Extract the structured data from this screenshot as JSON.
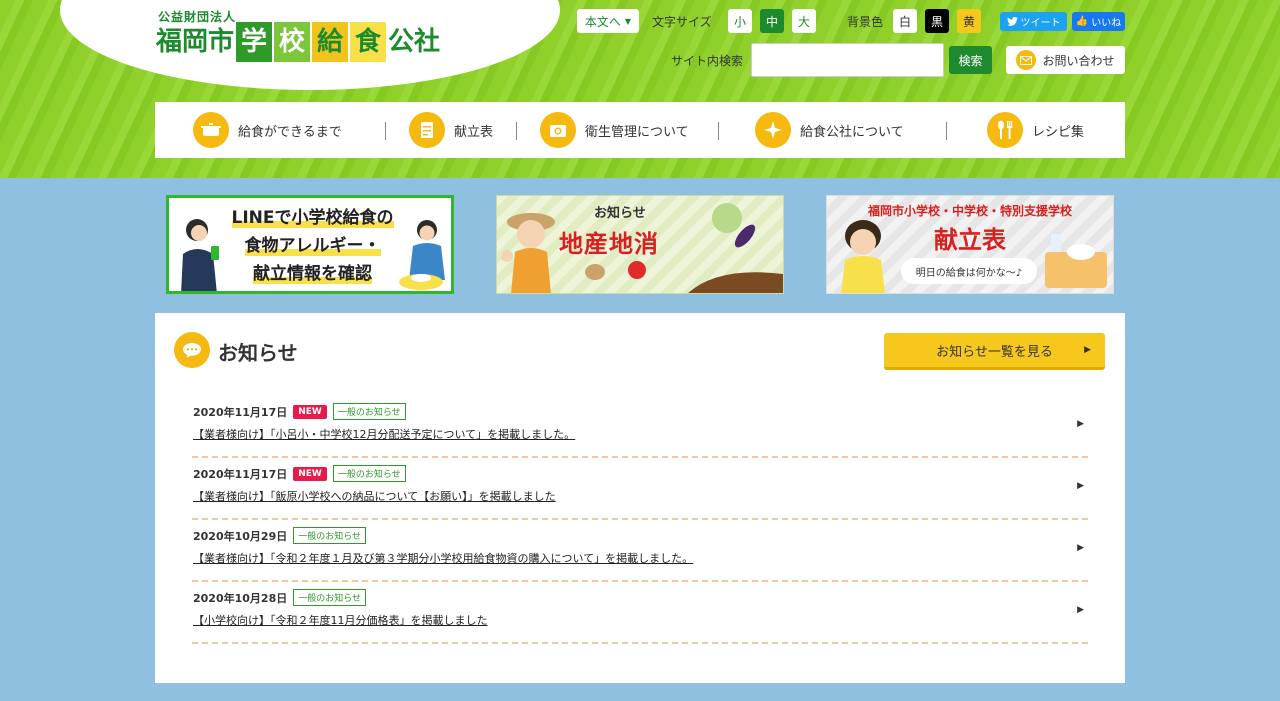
{
  "logo": {
    "org_type": "公益財団法人",
    "name_part1": "福岡市",
    "name_boxes": [
      "学",
      "校",
      "給",
      "食"
    ],
    "name_part2": "公社"
  },
  "utility": {
    "skip_label": "本文へ",
    "font_size_label": "文字サイズ",
    "font_sizes": [
      "小",
      "中",
      "大"
    ],
    "bg_color_label": "背景色",
    "bg_colors": [
      {
        "label": "白",
        "bg": "#ffffff",
        "fg": "#333333"
      },
      {
        "label": "黒",
        "bg": "#000000",
        "fg": "#ffffff"
      },
      {
        "label": "黄",
        "bg": "#f7c81c",
        "fg": "#333333"
      }
    ],
    "tweet_label": "ツイート",
    "like_label": "いいね",
    "search_label": "サイト内検索",
    "search_button": "検索",
    "search_value": "",
    "contact_label": "お問い合わせ"
  },
  "nav": {
    "items": [
      {
        "label": "給食ができるまで",
        "icon": "pot-icon"
      },
      {
        "label": "献立表",
        "icon": "document-icon"
      },
      {
        "label": "衛生管理について",
        "icon": "camera-icon"
      },
      {
        "label": "給食公社について",
        "icon": "sparkle-icon"
      },
      {
        "label": "レシピ集",
        "icon": "utensils-icon"
      }
    ]
  },
  "banners": {
    "line": {
      "lines": [
        "LINEで小学校給食の",
        "食物アレルギー・",
        "献立情報を確認"
      ]
    },
    "local": {
      "label": "お知らせ",
      "title": "地産地消"
    },
    "menu": {
      "subtitle": "福岡市小学校・中学校・特別支援学校",
      "title": "献立表",
      "bubble": "明日の給食は何かな〜♪"
    }
  },
  "news": {
    "heading": "お知らせ",
    "view_all": "お知らせ一覧を見る",
    "items": [
      {
        "date": "2020年11月17日",
        "new": "NEW",
        "category": "一般のお知らせ",
        "title": "【業者様向け】「小呂小・中学校12月分配送予定について」を掲載しました。"
      },
      {
        "date": "2020年11月17日",
        "new": "NEW",
        "category": "一般のお知らせ",
        "title": "【業者様向け】「飯原小学校への納品について【お願い】」を掲載しました"
      },
      {
        "date": "2020年10月29日",
        "new": "",
        "category": "一般のお知らせ",
        "title": "【業者様向け】「令和２年度１月及び第３学期分小学校用給食物資の購入について」を掲載しました。"
      },
      {
        "date": "2020年10月28日",
        "new": "",
        "category": "一般のお知らせ",
        "title": "【小学校向け】「令和２年度11月分価格表」を掲載しました"
      }
    ]
  },
  "colors": {
    "accent_green": "#1e8a2e",
    "accent_yellow": "#f5b90f",
    "new_badge": "#e8194b",
    "background": "#8fc0df"
  }
}
